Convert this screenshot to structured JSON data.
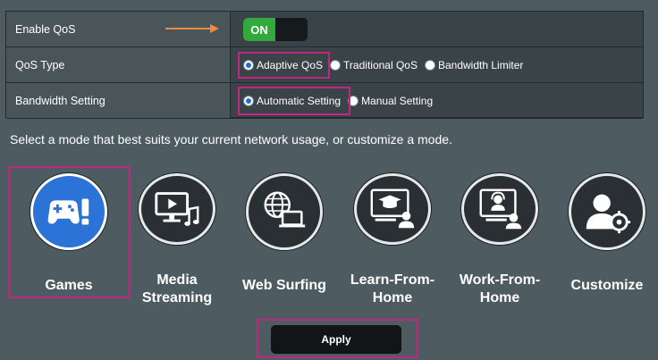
{
  "settings": {
    "enable_qos": {
      "label": "Enable QoS",
      "toggle_text": "ON"
    },
    "qos_type": {
      "label": "QoS Type",
      "options": [
        {
          "label": "Adaptive QoS",
          "checked": true
        },
        {
          "label": "Traditional QoS",
          "checked": false
        },
        {
          "label": "Bandwidth Limiter",
          "checked": false
        }
      ]
    },
    "bandwidth_setting": {
      "label": "Bandwidth Setting",
      "options": [
        {
          "label": "Automatic Setting",
          "checked": true
        },
        {
          "label": "Manual Setting",
          "checked": false
        }
      ]
    }
  },
  "instruction": "Select a mode that best suits your current network usage, or customize a mode.",
  "modes": [
    {
      "label": "Games",
      "icon": "gamepad-icon",
      "selected": true
    },
    {
      "label": "Media\nStreaming",
      "icon": "media-streaming-icon",
      "selected": false
    },
    {
      "label": "Web Surfing",
      "icon": "web-surfing-icon",
      "selected": false
    },
    {
      "label": "Learn-From-\nHome",
      "icon": "learn-from-home-icon",
      "selected": false
    },
    {
      "label": "Work-From-\nHome",
      "icon": "work-from-home-icon",
      "selected": false
    },
    {
      "label": "Customize",
      "icon": "customize-icon",
      "selected": false
    }
  ],
  "apply_label": "Apply",
  "colors": {
    "background": "#4e5c61",
    "toggle_on": "#32a93c",
    "selected_mode": "#2b73d6",
    "highlight": "#c0277f",
    "arrow": "#f08a3c"
  }
}
